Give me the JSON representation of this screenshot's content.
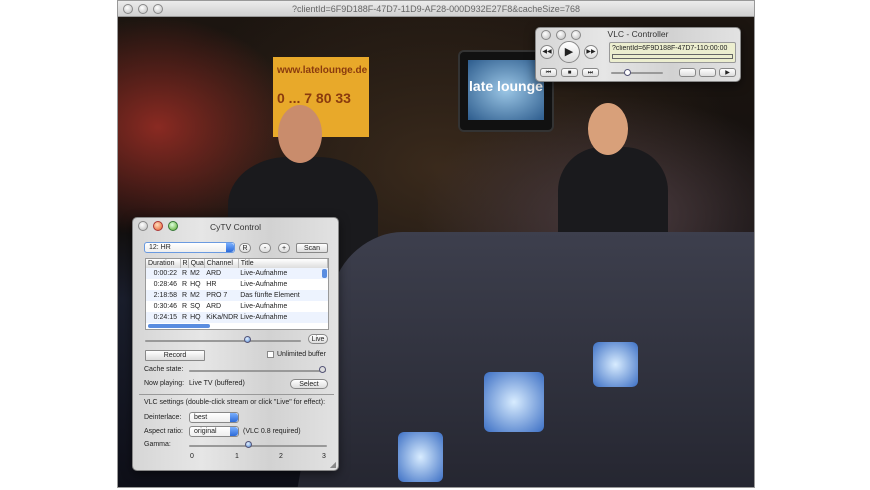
{
  "main_window": {
    "title": "?clientId=6F9D188F-47D7-11D9-AF28-000D932E27F8&cacheSize=768"
  },
  "video": {
    "sign_text": "www.latelounge.de",
    "sign_phone": "0 ... 7 80 33",
    "tv_logo": "late lounge"
  },
  "vlc_controller": {
    "title": "VLC - Controller",
    "stream": "?clientId=6F9D188F-47D7-11D9",
    "time": "0:00:00"
  },
  "cytv": {
    "title": "CyTV Control",
    "channel_select": "12: HR",
    "buttons": {
      "r": "R",
      "minus": "-",
      "plus": "+",
      "scan": "Scan",
      "live": "Live",
      "record": "Record",
      "select": "Select"
    },
    "table": {
      "headers": [
        "Duration",
        "R",
        "Qua",
        "Channel",
        "Title"
      ],
      "rows": [
        [
          "0:00:22",
          "R",
          "M2",
          "ARD",
          "Live-Aufnahme"
        ],
        [
          "0:28:46",
          "R",
          "HQ",
          "HR",
          "Live-Aufnahme"
        ],
        [
          "2:18:58",
          "R",
          "M2",
          "PRO 7",
          "Das fünfte Element"
        ],
        [
          "0:30:46",
          "R",
          "SQ",
          "ARD",
          "Live-Aufnahme"
        ],
        [
          "0:24:15",
          "R",
          "HQ",
          "KiKa/NDR",
          "Live-Aufnahme"
        ]
      ]
    },
    "unlimited_buffer": "Unlimited buffer",
    "cache_state_label": "Cache state:",
    "now_playing_label": "Now playing:",
    "now_playing_value": "Live TV (buffered)",
    "vlc_settings": "VLC settings (double-click stream or click \"Live\" for effect):",
    "deinterlace_label": "Deinterlace:",
    "deinterlace_value": "best",
    "aspect_label": "Aspect ratio:",
    "aspect_value": "original",
    "aspect_note": "(VLC 0.8 required)",
    "gamma_label": "Gamma:",
    "gamma_ticks": [
      "0",
      "1",
      "2",
      "3"
    ],
    "gamma_value": 1.3
  }
}
